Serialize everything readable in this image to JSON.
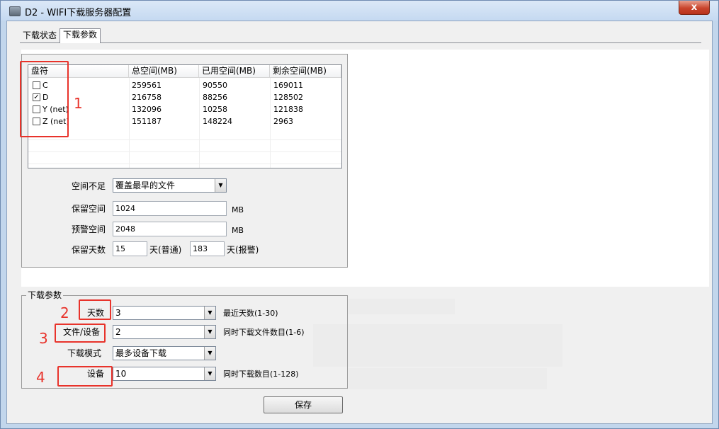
{
  "window": {
    "title": "D2 - WIFI下载服务器配置",
    "close_label": "x"
  },
  "tabs": [
    {
      "label": "下载状态",
      "active": false
    },
    {
      "label": "下载参数",
      "active": true
    }
  ],
  "disk_table": {
    "columns": [
      "盘符",
      "总空间(MB)",
      "已用空间(MB)",
      "剩余空间(MB)"
    ],
    "rows": [
      {
        "checked": false,
        "drive": "C",
        "total": "259561",
        "used": "90550",
        "free": "169011"
      },
      {
        "checked": true,
        "drive": "D",
        "total": "216758",
        "used": "88256",
        "free": "128502"
      },
      {
        "checked": false,
        "drive": "Y (net)",
        "total": "132096",
        "used": "10258",
        "free": "121838"
      },
      {
        "checked": false,
        "drive": "Z (net)",
        "total": "151187",
        "used": "148224",
        "free": "2963"
      }
    ]
  },
  "storage": {
    "insufficient_label": "空间不足",
    "insufficient_value": "覆盖最早的文件",
    "reserve_label": "保留空间",
    "reserve_value": "1024",
    "reserve_unit": "MB",
    "warn_label": "预警空间",
    "warn_value": "2048",
    "warn_unit": "MB",
    "keep_days_label": "保留天数",
    "keep_days_normal": "15",
    "normal_unit": "天(普通)",
    "keep_days_alarm": "183",
    "alarm_unit": "天(报警)"
  },
  "download_params": {
    "group_title": "下载参数",
    "days_label": "天数",
    "days_value": "3",
    "days_hint": "最近天数(1-30)",
    "files_label": "文件/设备",
    "files_value": "2",
    "files_hint": "同时下载文件数目(1-6)",
    "mode_label": "下载模式",
    "mode_value": "最多设备下载",
    "devices_label": "设备",
    "devices_value": "10",
    "devices_hint": "同时下载数目(1-128)"
  },
  "save_button": "保存",
  "annotations": [
    "1",
    "2",
    "3",
    "4"
  ],
  "colors": {
    "annotation": "#e8332b",
    "title_bar": "#c5d9f1",
    "close_button": "#c9452d"
  }
}
